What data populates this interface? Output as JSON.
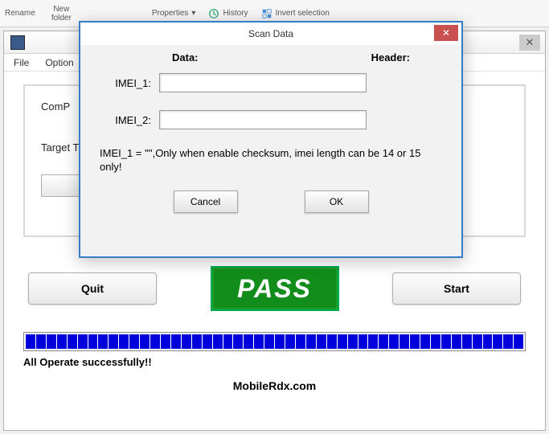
{
  "ribbon": {
    "rename": "Rename",
    "new_folder_line1": "New",
    "new_folder_line2": "folder",
    "properties": "Properties",
    "history": "History",
    "invert": "Invert selection"
  },
  "menubar": {
    "file": "File",
    "option": "Option"
  },
  "main": {
    "comport_label": "ComP",
    "target_label": "Target Ty",
    "quit": "Quit",
    "start": "Start",
    "pass": "PASS",
    "status": "All Operate successfully!!",
    "brand": "MobileRdx.com"
  },
  "dialog": {
    "title": "Scan Data",
    "data_label": "Data:",
    "header_label": "Header:",
    "imei1_label": "IMEI_1:",
    "imei1_value": "",
    "imei2_label": "IMEI_2:",
    "imei2_value": "",
    "message": "IMEI_1 = '\"',Only when enable checksum, imei length can be 14 or 15 only!",
    "cancel": "Cancel",
    "ok": "OK"
  }
}
